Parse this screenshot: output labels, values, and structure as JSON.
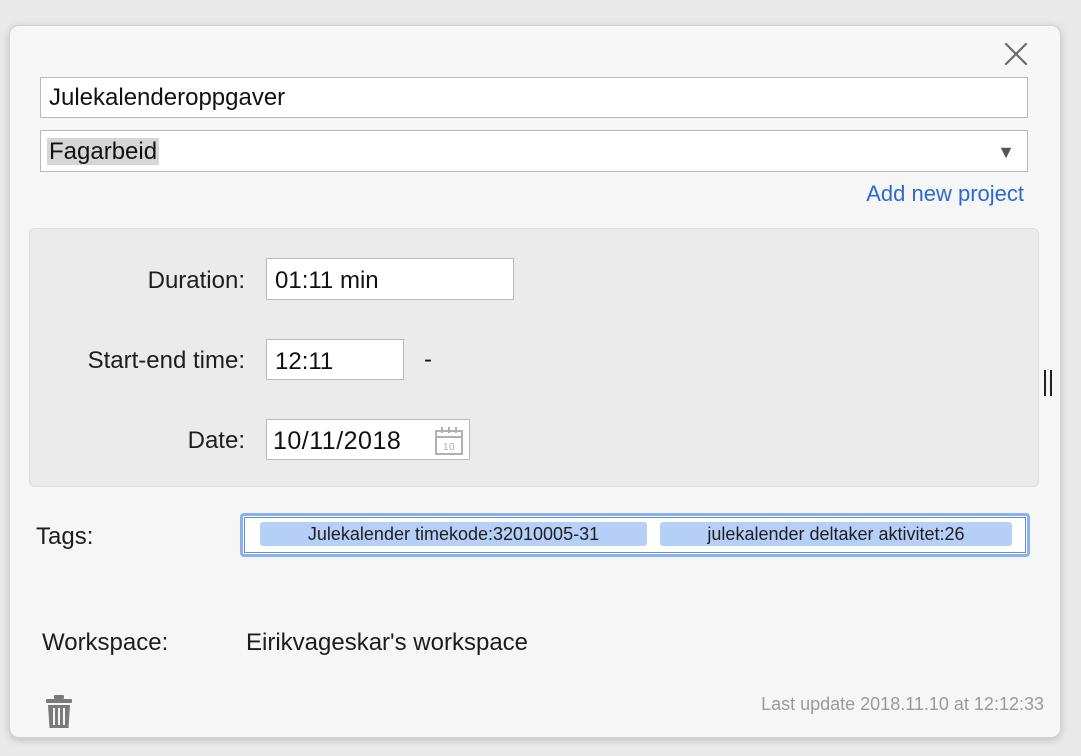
{
  "entry": {
    "description": "Julekalenderoppgaver",
    "project": "Fagarbeid",
    "add_project_link": "Add new project"
  },
  "time": {
    "duration_label": "Duration:",
    "duration_value": "01:11 min",
    "startend_label": "Start-end time:",
    "start_value": "12:11",
    "separator": "-",
    "date_label": "Date:",
    "date_value": "10/11/2018"
  },
  "tags": {
    "label": "Tags:",
    "items": [
      "Julekalender timekode:32010005-31",
      "julekalender deltaker aktivitet:26"
    ]
  },
  "workspace": {
    "label": "Workspace:",
    "value": "Eirikvageskar's workspace"
  },
  "footer": {
    "last_update": "Last update 2018.11.10 at 12:12:33"
  },
  "icons": {
    "close": "close-icon",
    "calendar": "calendar-icon",
    "trash": "trash-icon",
    "dropdown": "chevron-down-icon",
    "resize": "resize-handle-icon"
  },
  "colors": {
    "link": "#2a6ad0",
    "tag_bg": "#b6cff6",
    "focus_ring": "#8ab1ec",
    "muted_text": "#9a9a9a"
  }
}
